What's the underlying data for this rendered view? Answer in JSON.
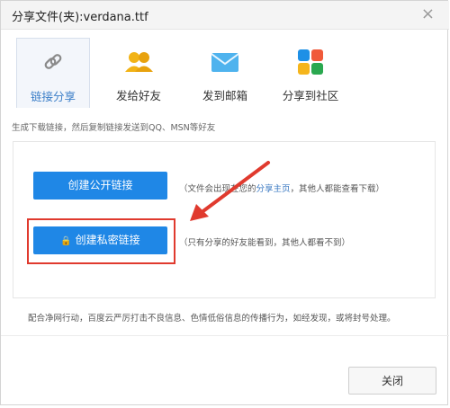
{
  "window": {
    "title": "分享文件(夹):verdana.ttf",
    "close_glyph": "×"
  },
  "tabs": [
    {
      "label": "链接分享",
      "icon": "link-icon",
      "active": true
    },
    {
      "label": "发给好友",
      "icon": "friends-icon",
      "active": false
    },
    {
      "label": "发到邮箱",
      "icon": "mail-icon",
      "active": false
    },
    {
      "label": "分享到社区",
      "icon": "community-icon",
      "active": false
    }
  ],
  "hint": "生成下载链接，然后复制链接发送到QQ、MSN等好友",
  "public_link": {
    "button_label": "创建公开链接",
    "desc_prefix": "（文件会出现在您的",
    "desc_accent": "分享主页",
    "desc_suffix": "，其他人都能查看下载）"
  },
  "private_link": {
    "button_label": "创建私密链接",
    "lock_glyph": "🔒",
    "desc": "（只有分享的好友能看到，其他人都看不到）"
  },
  "notice": "配合净网行动，百度云严厉打击不良信息、色情低俗信息的传播行为，如经发现，或将封号处理。",
  "footer": {
    "close_label": "关闭"
  },
  "colors": {
    "accent": "#1f87e6",
    "highlight": "#e03a2e",
    "active_tab_text": "#3c7fc8"
  }
}
